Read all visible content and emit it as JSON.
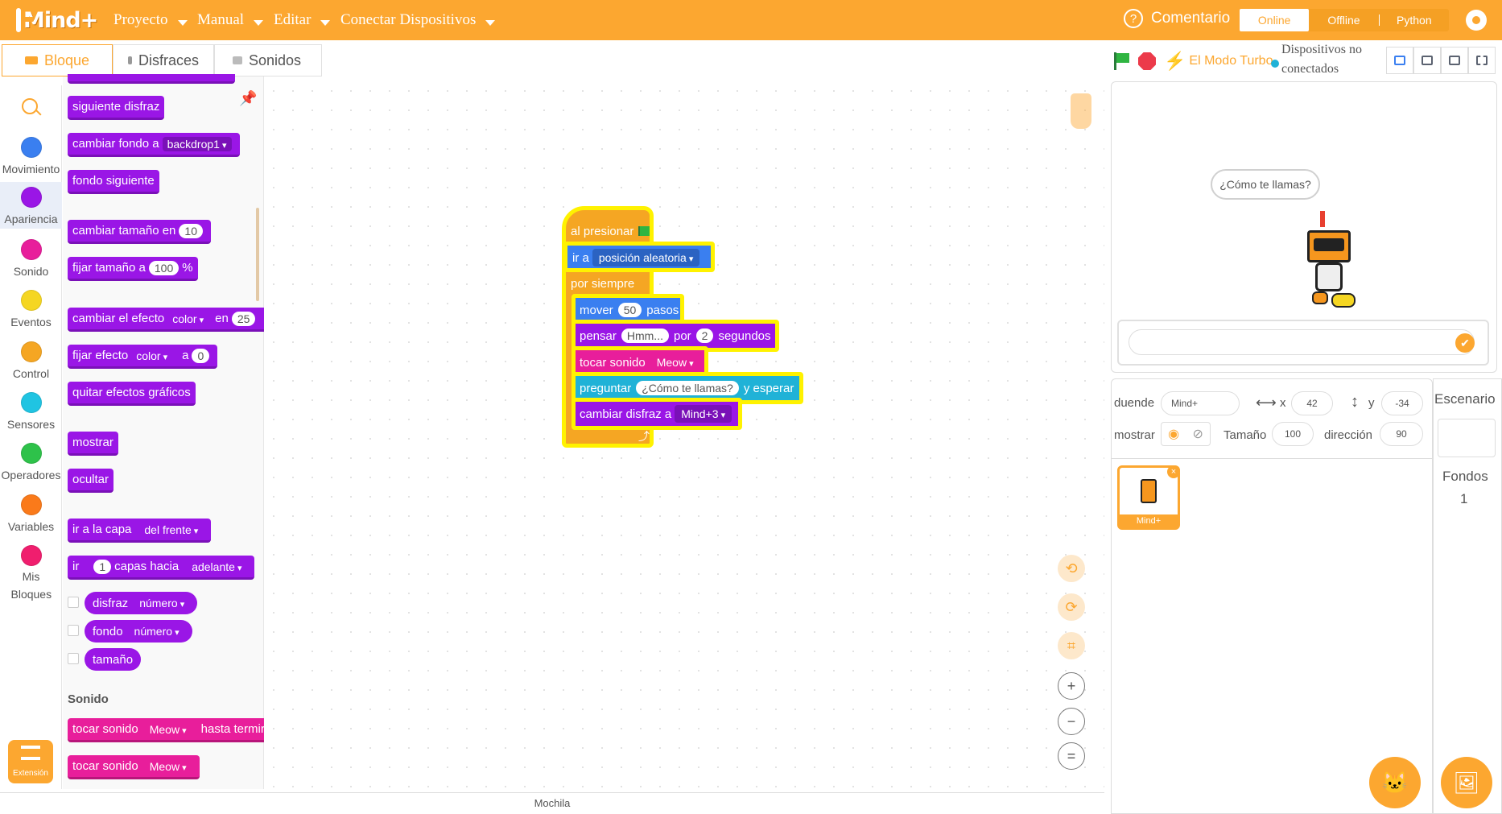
{
  "app": {
    "logo_text": "Mind+"
  },
  "menu": {
    "items": [
      "Proyecto",
      "Manual",
      "Editar",
      "Conectar Dispositivos"
    ]
  },
  "header": {
    "comment": "Comentario",
    "modes": [
      "Online",
      "Offline",
      "Python"
    ],
    "active_mode": "Online"
  },
  "tabs": {
    "labels": [
      "Bloque",
      "Disfraces",
      "Sonidos"
    ],
    "active": "Bloque"
  },
  "stage_toolbar": {
    "turbo": "El Modo Turbo",
    "device_status": "Dispositivos no conectados"
  },
  "categories": [
    {
      "label": "Movimiento",
      "color": "#3a7ff0"
    },
    {
      "label": "Apariencia",
      "color": "#9a16e6"
    },
    {
      "label": "Sonido",
      "color": "#e81e9b"
    },
    {
      "label": "Eventos",
      "color": "#f5d622"
    },
    {
      "label": "Control",
      "color": "#f5a623"
    },
    {
      "label": "Sensores",
      "color": "#20c4e2"
    },
    {
      "label": "Operadores",
      "color": "#2ec24a"
    },
    {
      "label": "Variables",
      "color": "#fa7a1a"
    },
    {
      "label": "Mis Bloques",
      "color": "#f01e6e"
    }
  ],
  "extension": {
    "label": "Extensión"
  },
  "palette": {
    "b1": "siguiente disfraz",
    "b2": {
      "text": "cambiar fondo a",
      "dd": "backdrop1"
    },
    "b3": "fondo siguiente",
    "b4": {
      "text": "cambiar tamaño en",
      "val": "10"
    },
    "b5": {
      "text": "fijar tamaño a",
      "val": "100",
      "unit": "%"
    },
    "b6": {
      "text": "cambiar el efecto",
      "dd": "color",
      "text2": "en",
      "val": "25"
    },
    "b7": {
      "text": "fijar efecto",
      "dd": "color",
      "text2": "a",
      "val": "0"
    },
    "b8": "quitar efectos gráficos",
    "b9": "mostrar",
    "b10": "ocultar",
    "b11": {
      "text": "ir a la capa",
      "dd": "del frente"
    },
    "b12": {
      "text": "ir",
      "val": "1",
      "text2": "capas hacia",
      "dd": "adelante"
    },
    "r1": {
      "text": "disfraz",
      "dd": "número"
    },
    "r2": {
      "text": "fondo",
      "dd": "número"
    },
    "r3": "tamaño",
    "section": "Sonido",
    "s1": {
      "text": "tocar sonido",
      "dd": "Meow",
      "text2": "hasta termir"
    },
    "s2": {
      "text": "tocar sonido",
      "dd": "Meow"
    }
  },
  "script": {
    "hat": "al presionar",
    "goto": {
      "text": "ir a",
      "dd": "posición aleatoria"
    },
    "forever": "por siempre",
    "move": {
      "text": "mover",
      "val": "50",
      "text2": "pasos"
    },
    "think": {
      "text": "pensar",
      "val": "Hmm...",
      "text2": "por",
      "val2": "2",
      "text3": "segundos"
    },
    "sound": {
      "text": "tocar sonido",
      "dd": "Meow"
    },
    "ask": {
      "text": "preguntar",
      "val": "¿Cómo te llamas?",
      "text2": "y esperar"
    },
    "costume": {
      "text": "cambiar disfraz a",
      "dd": "Mind+3"
    }
  },
  "workspace": {
    "backpack": "Mochila"
  },
  "stage": {
    "bubble": "¿Cómo te llamas?"
  },
  "sprite": {
    "label": "duende",
    "name": "Mind+",
    "x_label": "x",
    "x": "42",
    "y_label": "y",
    "y": "-34",
    "show_label": "mostrar",
    "size_label": "Tamaño",
    "size": "100",
    "dir_label": "dirección",
    "dir": "90",
    "thumb_label": "Mind+"
  },
  "stage_pane": {
    "title": "Escenario",
    "backdrops_label": "Fondos",
    "backdrops_count": "1"
  }
}
